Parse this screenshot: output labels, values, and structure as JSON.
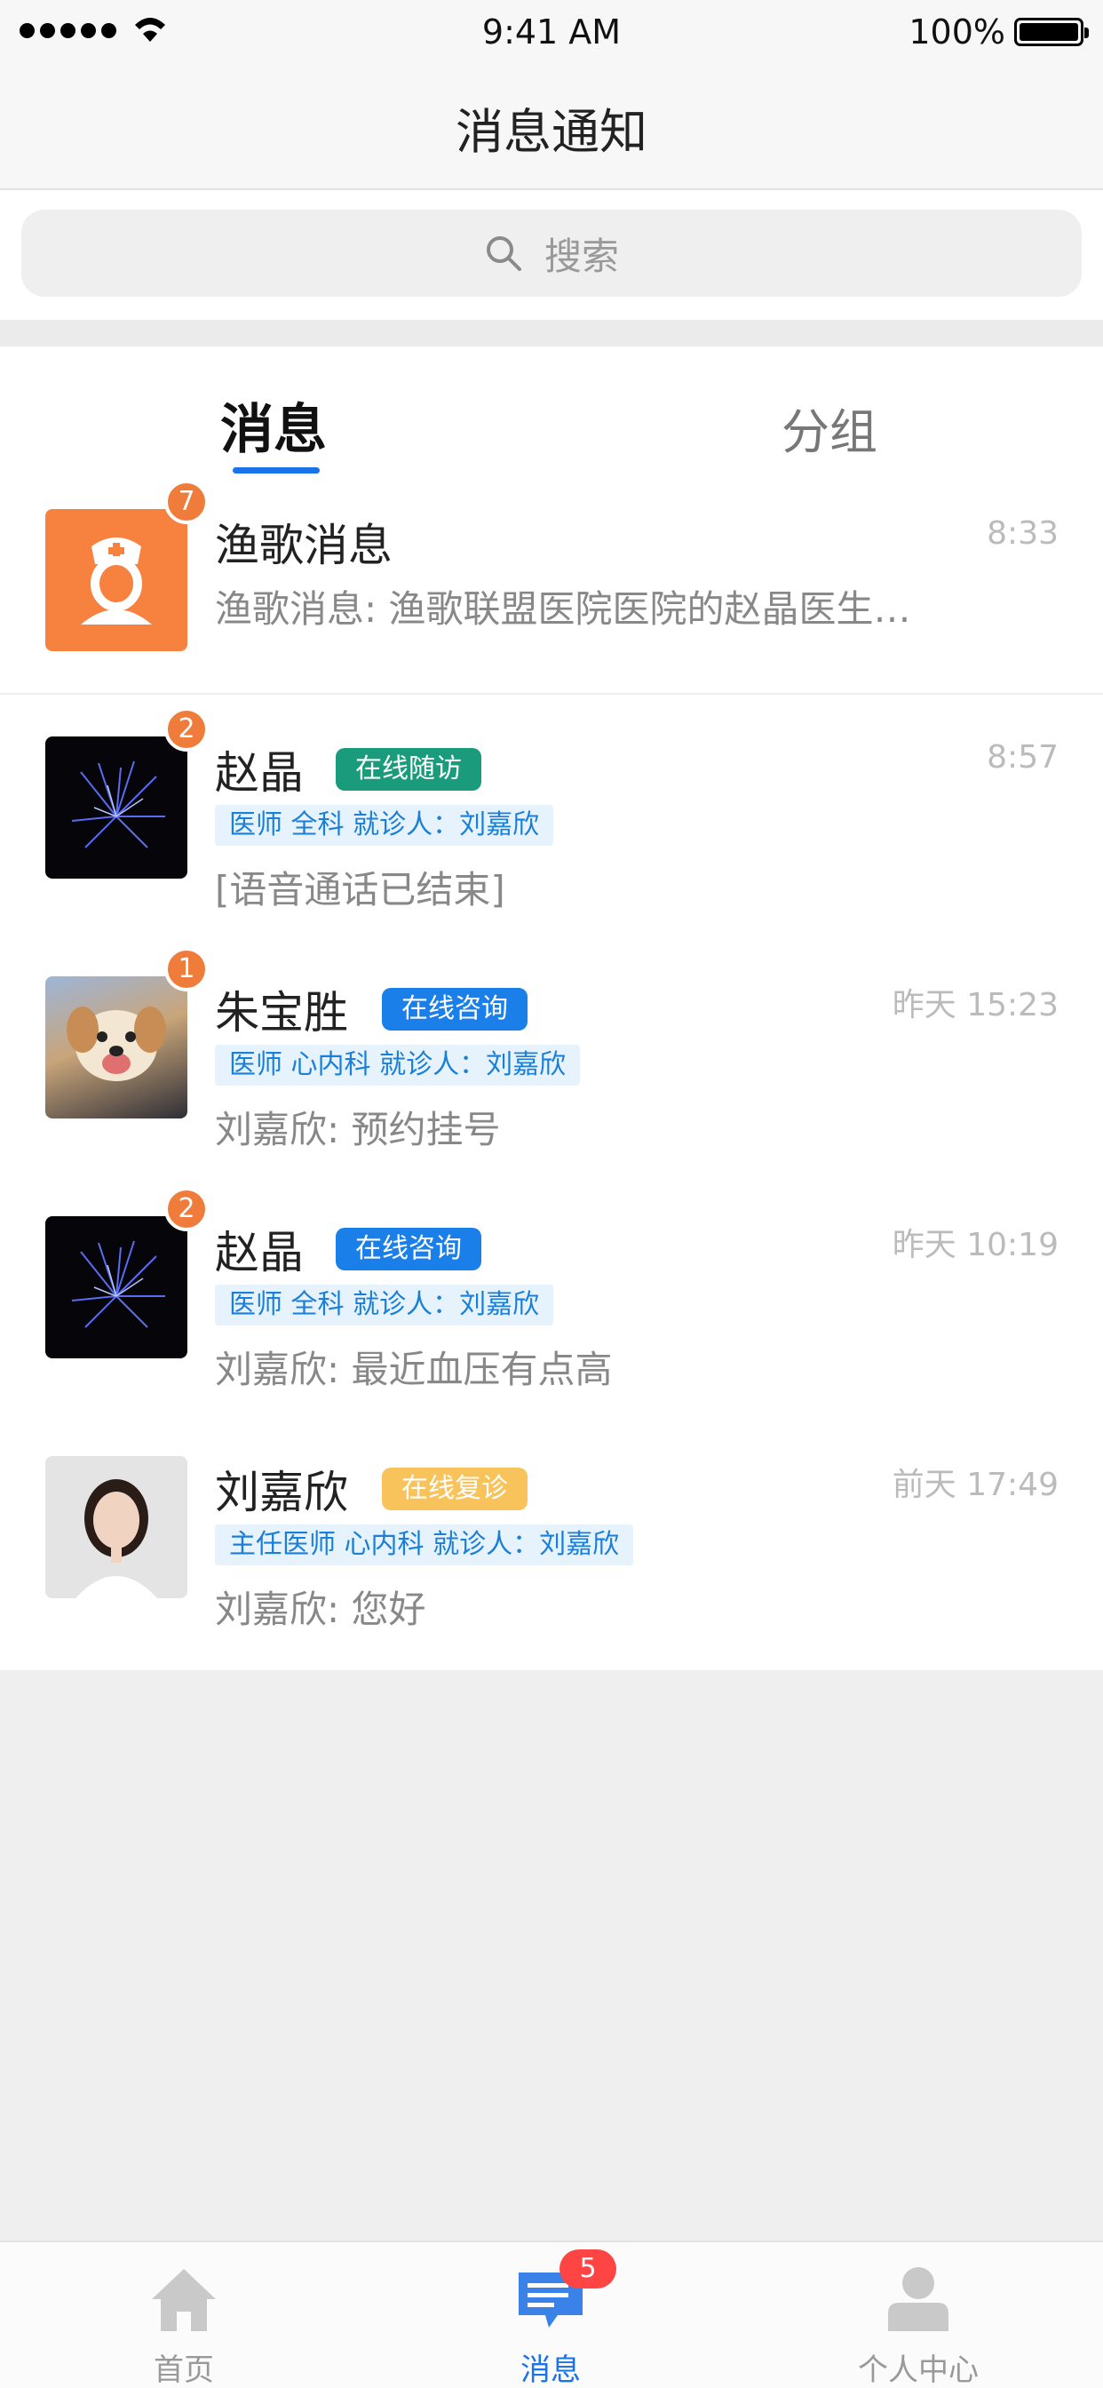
{
  "status_bar": {
    "time": "9:41 AM",
    "battery": "100%"
  },
  "nav": {
    "title": "消息通知"
  },
  "search": {
    "placeholder": "搜索"
  },
  "tabs": [
    {
      "label": "消息",
      "active": true
    },
    {
      "label": "分组",
      "active": false
    }
  ],
  "messages": [
    {
      "name": "渔歌消息",
      "badge": "7",
      "time": "8:33",
      "preview": "渔歌消息: 渔歌联盟医院医院的赵晶医生…"
    },
    {
      "name": "赵晶",
      "badge": "2",
      "tag": "在线随访",
      "tag_color": "#1a9b7b",
      "info": "医师  全科  就诊人：刘嘉欣",
      "time": "8:57",
      "preview": "[语音通话已结束]"
    },
    {
      "name": "朱宝胜",
      "badge": "1",
      "tag": "在线咨询",
      "tag_color": "#1a7fe8",
      "info": "医师  心内科  就诊人：刘嘉欣",
      "time": "昨天 15:23",
      "preview": "刘嘉欣: 预约挂号"
    },
    {
      "name": "赵晶",
      "badge": "2",
      "tag": "在线咨询",
      "tag_color": "#1a7fe8",
      "info": "医师  全科  就诊人：刘嘉欣",
      "time": "昨天 10:19",
      "preview": "刘嘉欣: 最近血压有点高"
    },
    {
      "name": "刘嘉欣",
      "tag": "在线复诊",
      "tag_color": "#f7c35a",
      "info": "主任医师  心内科  就诊人：刘嘉欣",
      "time": "前天 17:49",
      "preview": "刘嘉欣: 您好"
    }
  ],
  "tab_bar": {
    "items": [
      {
        "label": "首页",
        "icon": "home-icon"
      },
      {
        "label": "消息",
        "icon": "message-icon",
        "badge": "5",
        "active": true
      },
      {
        "label": "个人中心",
        "icon": "person-icon"
      }
    ]
  }
}
